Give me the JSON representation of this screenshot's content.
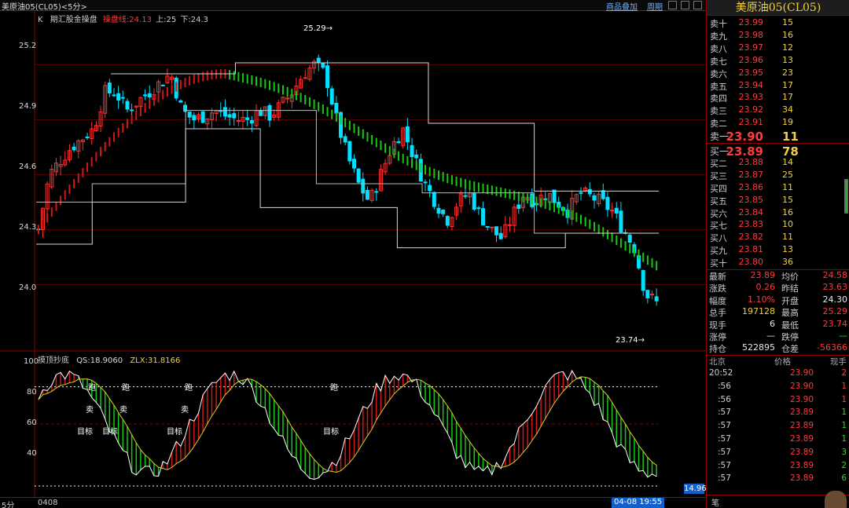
{
  "titlebar": {
    "symbol_text": "美原油05(CL05)<5分>",
    "links": [
      "商品叠加",
      "周期"
    ]
  },
  "main_chart": {
    "indicator_line": {
      "prefix": "K",
      "name": "期汇股金操盘",
      "op_label": "操盘线:24.13",
      "up": "上:25",
      "down": "下:24.3"
    },
    "price_axis": [
      "25.2",
      "24.9",
      "24.6",
      "24.3",
      "24.0"
    ],
    "annotations": {
      "high": "25.29",
      "low": "23.74"
    }
  },
  "sub_chart": {
    "title": "摸顶抄底",
    "qs_label": "QS:18.9060",
    "zlx_label": "ZLX:31.8166",
    "axis": [
      "100",
      "80",
      "60",
      "40"
    ],
    "signals": {
      "pao": [
        "跑",
        "跑",
        "跑",
        "跑"
      ],
      "mai": [
        "卖",
        "卖",
        "卖"
      ],
      "mubiao": [
        "目标",
        "目标",
        "目标",
        "目标"
      ]
    },
    "value_box": "14.96"
  },
  "bottom_bar": {
    "period": "5分",
    "date_left": "0408",
    "cursor_time": "04-08 19:55"
  },
  "chart_data": {
    "type": "candlestick",
    "title": "美原油05(CL05)",
    "period": "5分",
    "ylim": [
      23.65,
      25.45
    ],
    "yticks": [
      25.2,
      24.9,
      24.6,
      24.3,
      24.0
    ],
    "max_label": 25.29,
    "min_label": 23.74,
    "closes": [
      24.3,
      24.6,
      24.68,
      24.75,
      24.8,
      24.85,
      25.05,
      25.05,
      24.95,
      25.0,
      25.05,
      25.1,
      25.15,
      24.95,
      24.9,
      24.92,
      24.95,
      24.92,
      24.9,
      24.9,
      24.95,
      24.92,
      24.98,
      25.05,
      25.15,
      25.2,
      25.15,
      24.9,
      24.7,
      24.55,
      24.45,
      24.6,
      24.75,
      24.85,
      24.7,
      24.55,
      24.45,
      24.35,
      24.45,
      24.5,
      24.38,
      24.3,
      24.25,
      24.38,
      24.5,
      24.45,
      24.5,
      24.45,
      24.4,
      24.5,
      24.48,
      24.45,
      24.4,
      24.3,
      24.2,
      23.95,
      23.9
    ],
    "operating_line": {
      "start": 24.3,
      "peak": 25.15,
      "end": 24.13
    },
    "subchart": {
      "ylim": [
        0,
        100
      ],
      "ref_lines": [
        80,
        50,
        0
      ],
      "QS": 18.906,
      "ZLX": 31.8166
    }
  },
  "quote_panel": {
    "title": "美原油05(CL05)",
    "asks": [
      {
        "label": "卖十",
        "price": "23.99",
        "vol": "15"
      },
      {
        "label": "卖九",
        "price": "23.98",
        "vol": "16"
      },
      {
        "label": "卖八",
        "price": "23.97",
        "vol": "12"
      },
      {
        "label": "卖七",
        "price": "23.96",
        "vol": "13"
      },
      {
        "label": "卖六",
        "price": "23.95",
        "vol": "23"
      },
      {
        "label": "卖五",
        "price": "23.94",
        "vol": "17"
      },
      {
        "label": "卖四",
        "price": "23.93",
        "vol": "17"
      },
      {
        "label": "卖三",
        "price": "23.92",
        "vol": "34"
      },
      {
        "label": "卖二",
        "price": "23.91",
        "vol": "19"
      },
      {
        "label": "卖一",
        "price": "23.90",
        "vol": "11"
      }
    ],
    "bids": [
      {
        "label": "买一",
        "price": "23.89",
        "vol": "78"
      },
      {
        "label": "买二",
        "price": "23.88",
        "vol": "14"
      },
      {
        "label": "买三",
        "price": "23.87",
        "vol": "25"
      },
      {
        "label": "买四",
        "price": "23.86",
        "vol": "11"
      },
      {
        "label": "买五",
        "price": "23.85",
        "vol": "15"
      },
      {
        "label": "买六",
        "price": "23.84",
        "vol": "16"
      },
      {
        "label": "买七",
        "price": "23.83",
        "vol": "10"
      },
      {
        "label": "买八",
        "price": "23.82",
        "vol": "11"
      },
      {
        "label": "买九",
        "price": "23.81",
        "vol": "13"
      },
      {
        "label": "买十",
        "price": "23.80",
        "vol": "36"
      }
    ],
    "stats": [
      {
        "l1": "最新",
        "v1": "23.89",
        "l2": "均价",
        "v2": "24.58"
      },
      {
        "l1": "涨跌",
        "v1": "0.26",
        "l2": "昨结",
        "v2": "23.63"
      },
      {
        "l1": "幅度",
        "v1": "1.10%",
        "l2": "开盘",
        "v2": "24.30"
      },
      {
        "l1": "总手",
        "v1": "197128",
        "l2": "最高",
        "v2": "25.29"
      },
      {
        "l1": "现手",
        "v1": "6",
        "l2": "最低",
        "v2": "23.74"
      },
      {
        "l1": "涨停",
        "v1": "—",
        "l2": "跌停",
        "v2": "—"
      },
      {
        "l1": "持仓",
        "v1": "522895",
        "l2": "仓差",
        "v2": "-56366"
      }
    ],
    "ticks_header": {
      "c1": "北京",
      "c2": "价格",
      "c3": "现手"
    },
    "ticks": [
      {
        "time": "20:52",
        "price": "23.90",
        "vol": "2"
      },
      {
        "time": ":56",
        "price": "23.90",
        "vol": "1"
      },
      {
        "time": ":56",
        "price": "23.90",
        "vol": "1"
      },
      {
        "time": ":57",
        "price": "23.89",
        "vol": "1"
      },
      {
        "time": ":57",
        "price": "23.89",
        "vol": "1"
      },
      {
        "time": ":57",
        "price": "23.89",
        "vol": "1"
      },
      {
        "time": ":57",
        "price": "23.89",
        "vol": "3"
      },
      {
        "time": ":57",
        "price": "23.89",
        "vol": "2"
      },
      {
        "time": ":57",
        "price": "23.89",
        "vol": "6"
      }
    ],
    "footer_label": "笔"
  }
}
